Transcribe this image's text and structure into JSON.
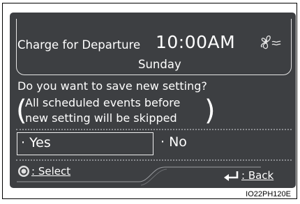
{
  "header": {
    "title": "Charge for Departure",
    "time": "10:00AM",
    "day": "Sunday",
    "icon": "fan-icon"
  },
  "dialog": {
    "question": "Do you want to save new setting?",
    "note_line1": "All scheduled events before",
    "note_line2": "new setting will be skipped"
  },
  "options": {
    "yes_label": "· Yes",
    "no_label": "· No",
    "selected": "yes"
  },
  "footer": {
    "select_label": ": Select",
    "back_label": ": Back",
    "select_icon": "dial-icon",
    "back_icon": "return-arrow-icon"
  },
  "caption": "IO22PH120E",
  "colors": {
    "screen_bg": "#3d3f42",
    "text": "#ffffff"
  }
}
